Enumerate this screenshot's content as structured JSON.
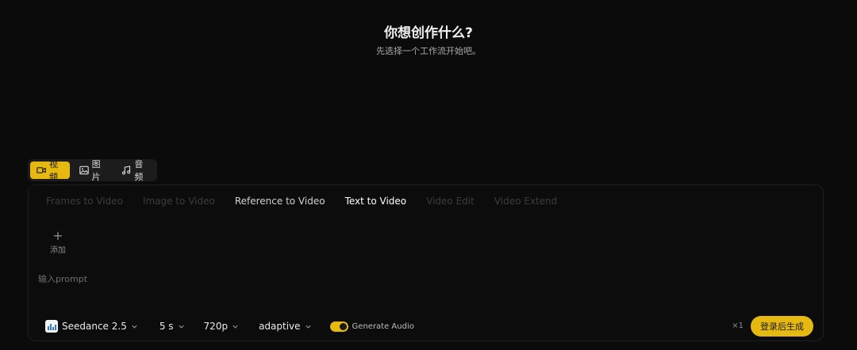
{
  "hero": {
    "title": "你想创作什么?",
    "subtitle": "先选择一个工作流开始吧。"
  },
  "mode_tabs": [
    {
      "label": "视频",
      "icon": "video-camera-icon",
      "active": true
    },
    {
      "label": "图片",
      "icon": "image-icon",
      "active": false
    },
    {
      "label": "音频",
      "icon": "music-note-icon",
      "active": false
    }
  ],
  "workflow_tabs": [
    {
      "label": "Frames to Video",
      "state": "disabled"
    },
    {
      "label": "Image to Video",
      "state": "disabled"
    },
    {
      "label": "Reference to Video",
      "state": "enabled"
    },
    {
      "label": "Text to Video",
      "state": "selected"
    },
    {
      "label": "Video Edit",
      "state": "disabled"
    },
    {
      "label": "Video Extend",
      "state": "disabled"
    }
  ],
  "add_button": {
    "icon": "plus-icon",
    "label": "添加"
  },
  "prompt": {
    "placeholder": "输入prompt",
    "value": ""
  },
  "toolbar": {
    "model": "Seedance 2.5",
    "duration": "5 s",
    "resolution": "720p",
    "aspect": "adaptive",
    "audio_label": "Generate Audio",
    "audio_enabled": true
  },
  "count_label": "×1",
  "generate_label": "登录后生成",
  "colors": {
    "accent": "#e5b90f",
    "background": "#0b0b0b",
    "panel_border": "#1f1f1f"
  }
}
